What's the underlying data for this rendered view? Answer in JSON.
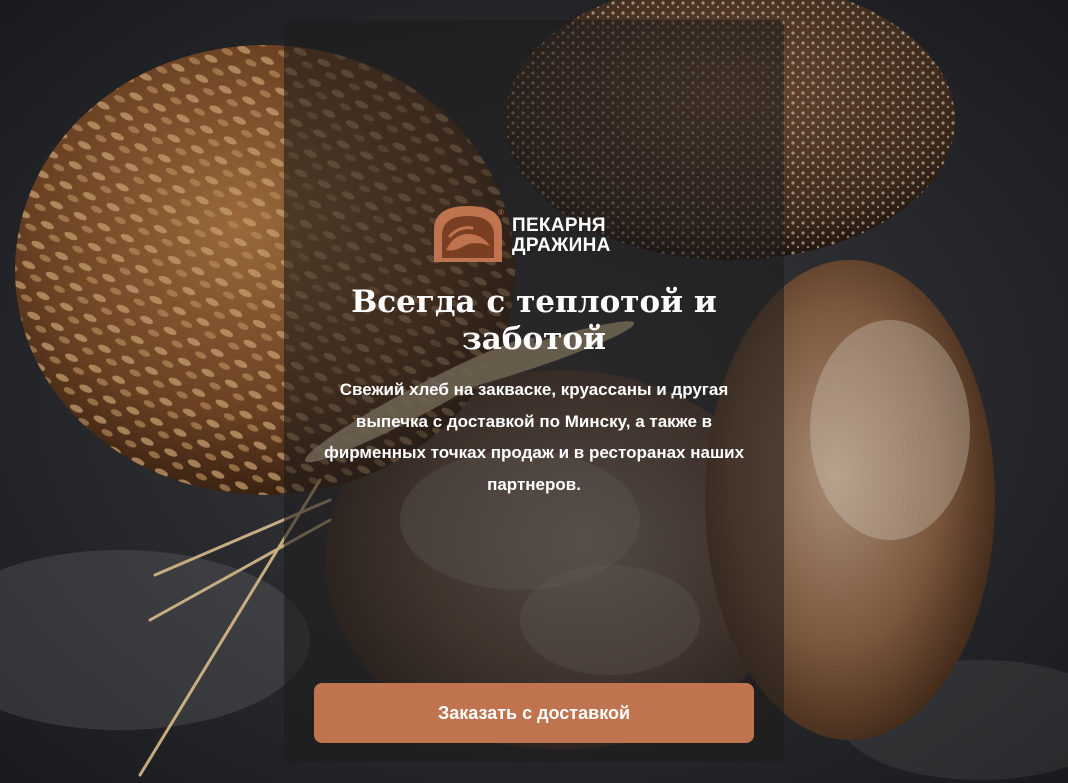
{
  "colors": {
    "accent": "#c0734f",
    "text": "#ffffff",
    "overlay": "rgba(30,28,27,0.58)",
    "background": "#1c1d20"
  },
  "brand": {
    "logo_icon": "bread-oven-icon",
    "name_line1": "ПЕКАРНЯ",
    "name_line2": "ДРАЖИНА",
    "trademark": "®"
  },
  "hero": {
    "title": "Всегда с теплотой и заботой",
    "subtitle": "Свежий хлеб на закваске, круассаны и другая выпечка с доставкой по Минску, а также в фирменных точках продаж и в ресторанах наших партнеров.",
    "cta_label": "Заказать с доставкой"
  }
}
